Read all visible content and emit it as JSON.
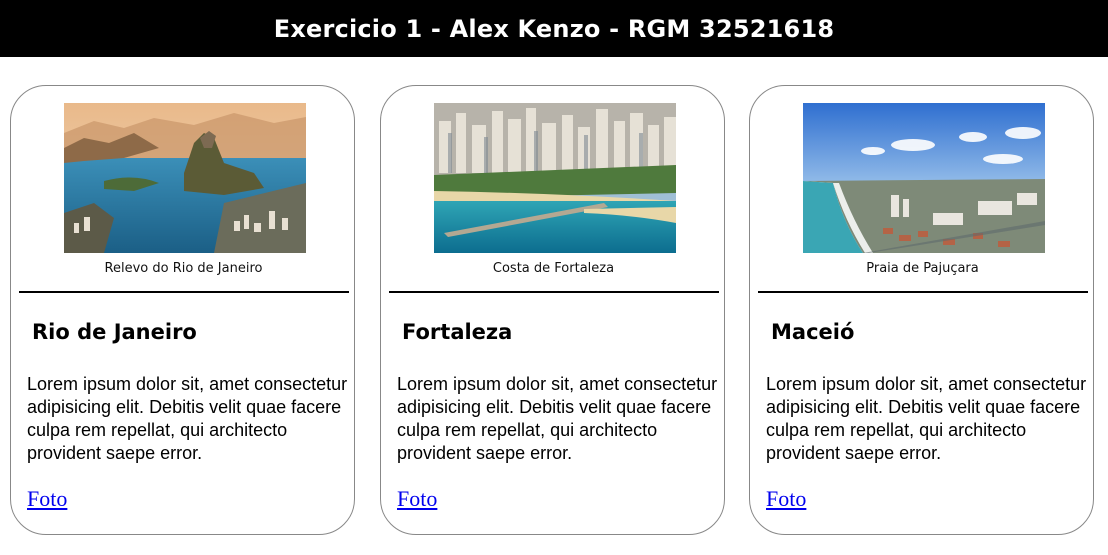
{
  "header": {
    "title": "Exercicio 1 - Alex Kenzo - RGM 32521618"
  },
  "cards": [
    {
      "image_icon": "rio-landscape-image",
      "caption": "Relevo do Rio de Janeiro",
      "city": "Rio de Janeiro",
      "description": "Lorem ipsum dolor sit, amet consectetur adipisicing elit. Debitis velit quae facere culpa rem repellat, qui architecto provident saepe error.",
      "link_label": "Foto"
    },
    {
      "image_icon": "fortaleza-coast-image",
      "caption": "Costa de Fortaleza",
      "city": "Fortaleza",
      "description": "Lorem ipsum dolor sit, amet consectetur adipisicing elit. Debitis velit quae facere culpa rem repellat, qui architecto provident saepe error.",
      "link_label": "Foto"
    },
    {
      "image_icon": "pajucara-beach-image",
      "caption": "Praia de Pajuçara",
      "city": "Maceió",
      "description": "Lorem ipsum dolor sit, amet consectetur adipisicing elit. Debitis velit quae facere culpa rem repellat, qui architecto provident saepe error.",
      "link_label": "Foto"
    }
  ],
  "colors": {
    "header_bg": "#000000",
    "header_text": "#ffffff",
    "link": "#0000ee",
    "card_border": "#888888"
  }
}
